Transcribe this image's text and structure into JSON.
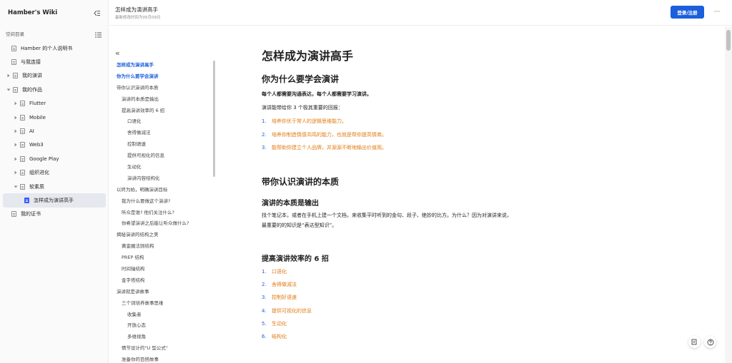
{
  "sidebar": {
    "title": "Hamber's Wiki",
    "section_label": "空间目录",
    "items": [
      {
        "label": "Hamber 的个人说明书",
        "caret": "none"
      },
      {
        "label": "与我连接",
        "caret": "none"
      },
      {
        "label": "我的演讲",
        "caret": "collapsed"
      },
      {
        "label": "我的作品",
        "caret": "expanded"
      },
      {
        "label": "Flutter",
        "caret": "collapsed"
      },
      {
        "label": "Mobile",
        "caret": "collapsed"
      },
      {
        "label": "AI",
        "caret": "collapsed"
      },
      {
        "label": "Web3",
        "caret": "collapsed"
      },
      {
        "label": "Google Play",
        "caret": "collapsed"
      },
      {
        "label": "组织进化",
        "caret": "collapsed"
      },
      {
        "label": "软素质",
        "caret": "expanded"
      },
      {
        "label": "怎样成为演讲高手",
        "caret": "none",
        "active": true
      },
      {
        "label": "我的证书",
        "caret": "none"
      }
    ]
  },
  "topbar": {
    "doc_title": "怎样成为演讲高手",
    "last_modified": "最新修改时间为05月09日",
    "login_label": "登录/注册",
    "more_label": "···"
  },
  "toc": {
    "items": [
      {
        "label": "怎样成为演讲高手",
        "level": 0,
        "active": true
      },
      {
        "label": "你为什么要学会演讲",
        "level": 0,
        "active": true
      },
      {
        "label": "带你认识演讲的本质",
        "level": 0
      },
      {
        "label": "演讲的本质是输出",
        "level": 1
      },
      {
        "label": "提高演讲效率的 6 招",
        "level": 1
      },
      {
        "label": "口语化",
        "level": 2
      },
      {
        "label": "舍得做减法",
        "level": 2
      },
      {
        "label": "控制语速",
        "level": 2
      },
      {
        "label": "提供可视化的信息",
        "level": 2
      },
      {
        "label": "生动化",
        "level": 2
      },
      {
        "label": "演讲内容结构化",
        "level": 2
      },
      {
        "label": "以终为始，明确演讲目标",
        "level": 0
      },
      {
        "label": "我为什么要做这个演讲?",
        "level": 1
      },
      {
        "label": "听众是谁? 他们关注什么?",
        "level": 1
      },
      {
        "label": "你希望演讲之后能让听众做什么?",
        "level": 1
      },
      {
        "label": "揭秘演讲的结构之美",
        "level": 0
      },
      {
        "label": "黄金圈法则结构",
        "level": 1
      },
      {
        "label": "PREP 结构",
        "level": 1
      },
      {
        "label": "时间轴结构",
        "level": 1
      },
      {
        "label": "金字塔结构",
        "level": 1
      },
      {
        "label": "演讲就是讲故事",
        "level": 0
      },
      {
        "label": "三个词培养故事思维",
        "level": 1
      },
      {
        "label": "收集者",
        "level": 2
      },
      {
        "label": "开放心态",
        "level": 2
      },
      {
        "label": "多维视角",
        "level": 2
      },
      {
        "label": "情节设计的\"U 型公式\"",
        "level": 1
      },
      {
        "label": "准备你的百搭故事",
        "level": 1
      }
    ]
  },
  "content": {
    "h1": "怎样成为演讲高手",
    "s1_title": "你为什么要学会演讲",
    "s1_bold": "每个人都需要沟通表达，每个人都需要学习演讲。",
    "s1_intro": "演讲能带给你 3 个极其重要的回报：",
    "s1_list": [
      {
        "num": "1.",
        "text": "培养你优于常人的逻辑思维能力。"
      },
      {
        "num": "2.",
        "text": "培养你制造情感共鸣的能力，也就是帮你提高情商。"
      },
      {
        "num": "3.",
        "text": "能帮助你建立个人品牌，并源源不断地输出价值观。"
      }
    ],
    "s2_title": "带你认识演讲的本质",
    "s2_sub": "演讲的本质是输出",
    "s2_p1": "找个笔记本，或者在手机上建一个文档，来收集平时听到的金句、段子、绝妙的比方。为什么？因为对演讲来说，",
    "s2_p2": "最重要的的知识是“表达型知识”。",
    "s3_title": "提高演讲效率的 6 招",
    "s3_list": [
      {
        "num": "1.",
        "text": "口语化"
      },
      {
        "num": "2.",
        "text": "舍得做减法"
      },
      {
        "num": "3.",
        "text": "控制好语速"
      },
      {
        "num": "4.",
        "text": "提供可视化的信息"
      },
      {
        "num": "5.",
        "text": "生动化"
      },
      {
        "num": "6.",
        "text": "结构化"
      }
    ]
  },
  "colors": {
    "accent": "#1a5fdb",
    "list_text": "#e07b13",
    "sidebar_bg": "#fafafa",
    "active_item_bg": "#e5e8ee"
  }
}
